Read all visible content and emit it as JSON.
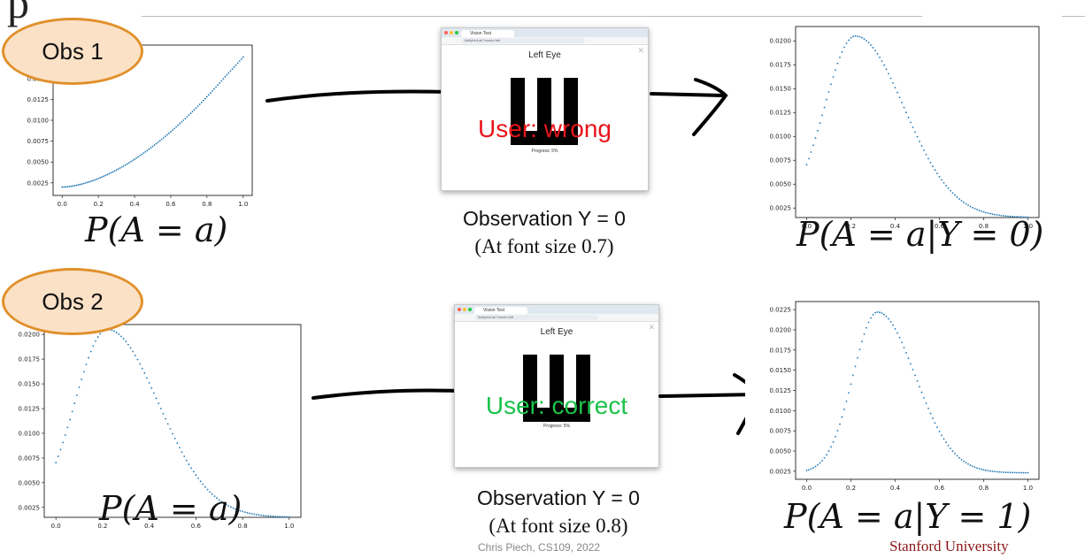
{
  "header": {
    "title_fragment": "p"
  },
  "colors": {
    "dots": "#1f77b4",
    "oval_fill": "#fbe1c6",
    "oval_border": "#e0902a",
    "wrong": "#e8151b",
    "correct": "#1bc24a",
    "stanford": "#8c1515"
  },
  "rows": [
    {
      "obs_badge": "Obs 1",
      "prior": {
        "formula": "P(A = a)",
        "x_ticks": [
          "0.0",
          "0.2",
          "0.4",
          "0.6",
          "0.8",
          "1.0"
        ],
        "y_ticks": [
          "0.0025",
          "0.0050",
          "0.0075",
          "0.0100",
          "0.0125",
          "0.0150"
        ]
      },
      "screenshot": {
        "tab_title": "Vision Test",
        "url": "fluffybird.ai/?mode=left",
        "eye_label": "Left Eye",
        "glyph": "Ш",
        "user_text": "User: wrong",
        "progress": "Progress: 5%"
      },
      "observation": {
        "label": "Observation Y = 0",
        "sub": "(At font size 0.7)"
      },
      "posterior": {
        "formula": "P(A = a|Y = 0)",
        "x_ticks": [
          "0.0",
          "0.2",
          "0.4",
          "0.6",
          "0.8",
          "1.0"
        ],
        "y_ticks": [
          "0.0025",
          "0.0050",
          "0.0075",
          "0.0100",
          "0.0125",
          "0.0150",
          "0.0175",
          "0.0200"
        ]
      }
    },
    {
      "obs_badge": "Obs 2",
      "prior": {
        "formula": "P(A = a)",
        "x_ticks": [
          "0.0",
          "0.2",
          "0.4",
          "0.6",
          "0.8",
          "1.0"
        ],
        "y_ticks": [
          "0.0025",
          "0.0050",
          "0.0075",
          "0.0100",
          "0.0125",
          "0.0150",
          "0.0175",
          "0.0200"
        ]
      },
      "screenshot": {
        "tab_title": "Vision Test",
        "url": "fluffybird.ai/?mode=left",
        "eye_label": "Left Eye",
        "glyph": "Ш",
        "user_text": "User: correct",
        "progress": "Progress: 5%"
      },
      "observation": {
        "label": "Observation Y = 0",
        "sub": "(At font size 0.8)"
      },
      "posterior": {
        "formula": "P(A = a|Y = 1)",
        "x_ticks": [
          "0.0",
          "0.2",
          "0.4",
          "0.6",
          "0.8",
          "1.0"
        ],
        "y_ticks": [
          "0.0025",
          "0.0050",
          "0.0075",
          "0.0100",
          "0.0125",
          "0.0150",
          "0.0175",
          "0.0200",
          "0.0225"
        ]
      }
    }
  ],
  "footer": {
    "credit": "Chris Piech, CS109, 2022",
    "university": "Stanford University"
  }
}
